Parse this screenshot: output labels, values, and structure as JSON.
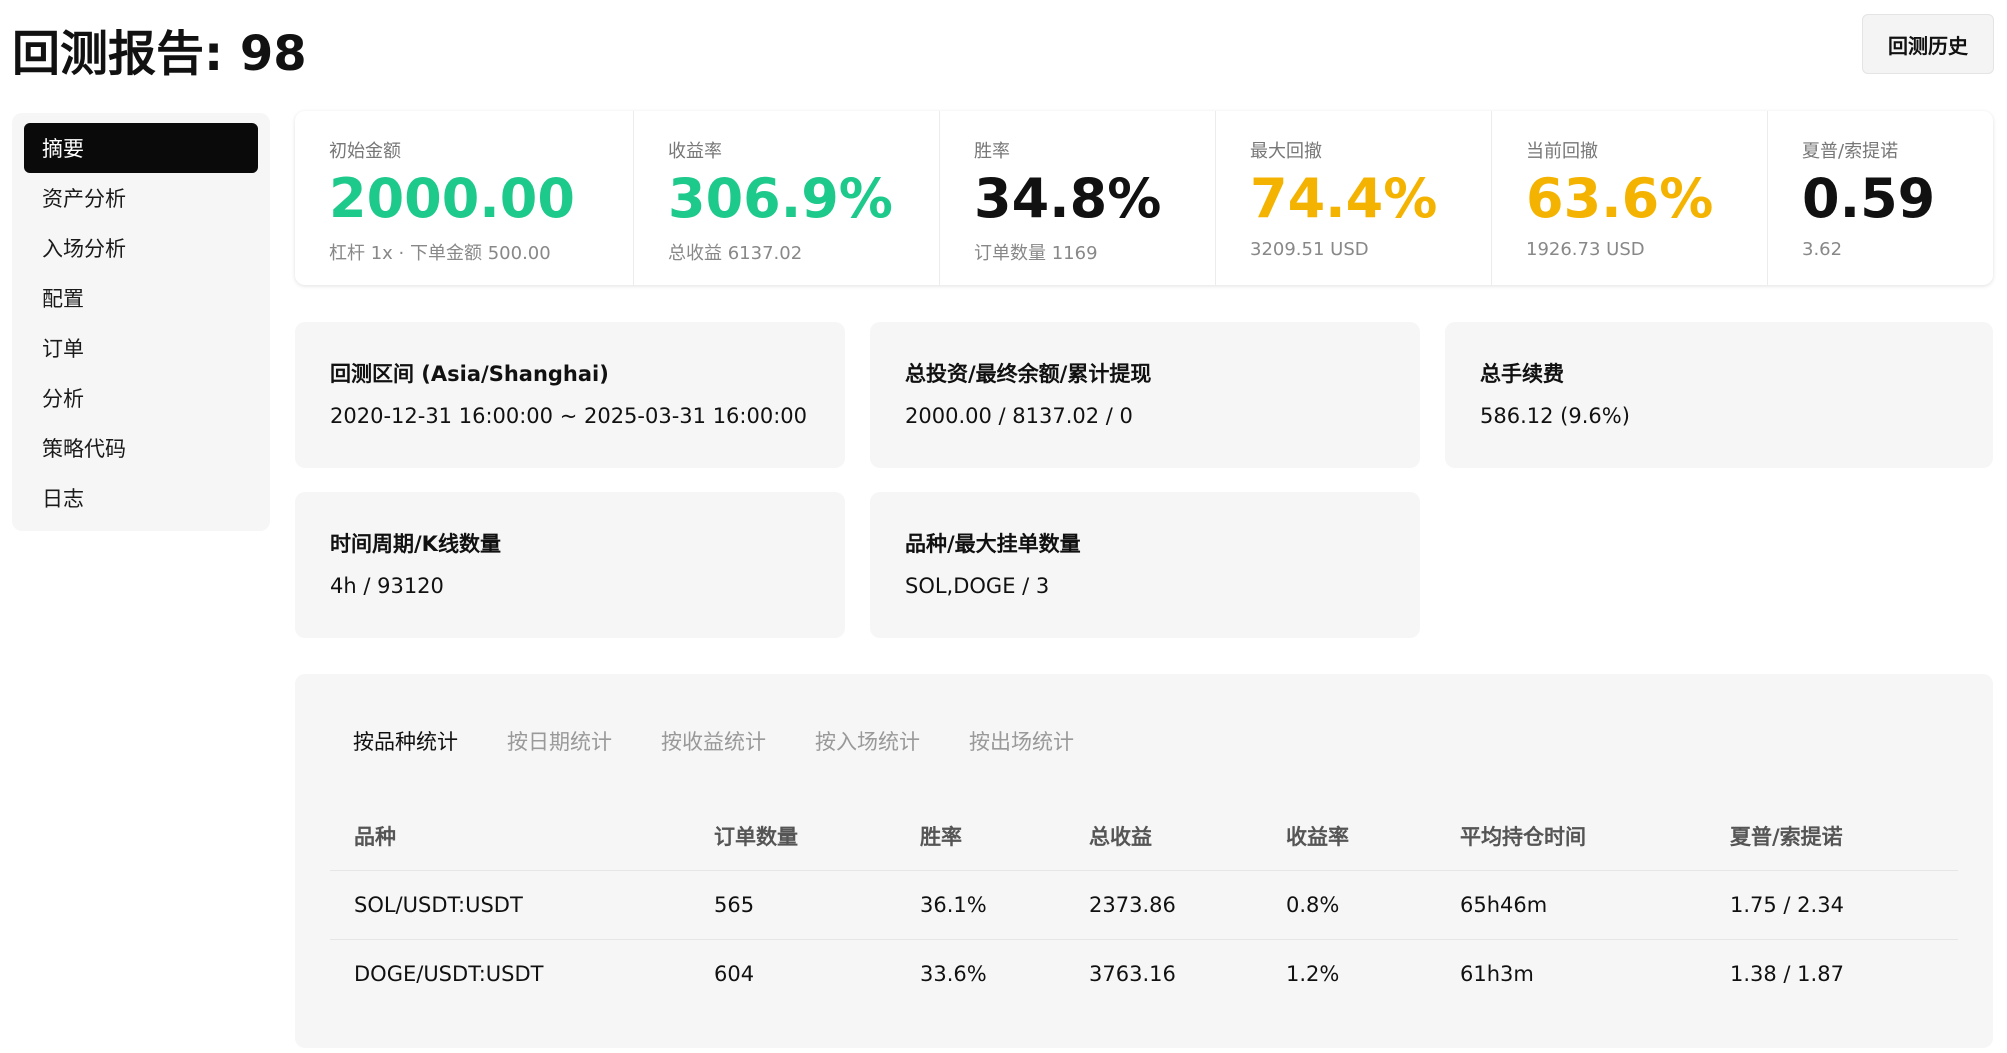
{
  "header": {
    "title": "回测报告: 98",
    "history_button": "回测历史"
  },
  "sidebar": {
    "items": [
      {
        "label": "摘要",
        "active": true
      },
      {
        "label": "资产分析"
      },
      {
        "label": "入场分析"
      },
      {
        "label": "配置"
      },
      {
        "label": "订单"
      },
      {
        "label": "分析"
      },
      {
        "label": "策略代码"
      },
      {
        "label": "日志"
      }
    ]
  },
  "metrics": [
    {
      "label": "初始金额",
      "value": "2000.00",
      "sub": "杠杆 1x · 下单金额 500.00",
      "color": "#1dc98b"
    },
    {
      "label": "收益率",
      "value": "306.9%",
      "sub": "总收益 6137.02",
      "color": "#1dc98b"
    },
    {
      "label": "胜率",
      "value": "34.8%",
      "sub": "订单数量 1169",
      "color": "#111111"
    },
    {
      "label": "最大回撤",
      "value": "74.4%",
      "sub": "3209.51 USD",
      "color": "#f5b301"
    },
    {
      "label": "当前回撤",
      "value": "63.6%",
      "sub": "1926.73 USD",
      "color": "#f5b301"
    },
    {
      "label": "夏普/索提诺",
      "value": "0.59",
      "sub": "3.62",
      "color": "#111111"
    }
  ],
  "info_cards": [
    {
      "title": "回测区间 (Asia/Shanghai)",
      "value": "2020-12-31 16:00:00 ~ 2025-03-31 16:00:00"
    },
    {
      "title": "总投资/最终余额/累计提现",
      "value": "2000.00 / 8137.02 / 0"
    },
    {
      "title": "总手续费",
      "value": "586.12 (9.6%)"
    },
    {
      "title": "时间周期/K线数量",
      "value": "4h / 93120"
    },
    {
      "title": "品种/最大挂单数量",
      "value": "SOL,DOGE / 3"
    }
  ],
  "stats": {
    "tabs": [
      "按品种统计",
      "按日期统计",
      "按收益统计",
      "按入场统计",
      "按出场统计"
    ],
    "active_tab": 0,
    "columns": [
      "品种",
      "订单数量",
      "胜率",
      "总收益",
      "收益率",
      "平均持仓时间",
      "夏普/索提诺"
    ],
    "rows": [
      [
        "SOL/USDT:USDT",
        "565",
        "36.1%",
        "2373.86",
        "0.8%",
        "65h46m",
        "1.75 / 2.34"
      ],
      [
        "DOGE/USDT:USDT",
        "604",
        "33.6%",
        "3763.16",
        "1.2%",
        "61h3m",
        "1.38 / 1.87"
      ]
    ]
  }
}
